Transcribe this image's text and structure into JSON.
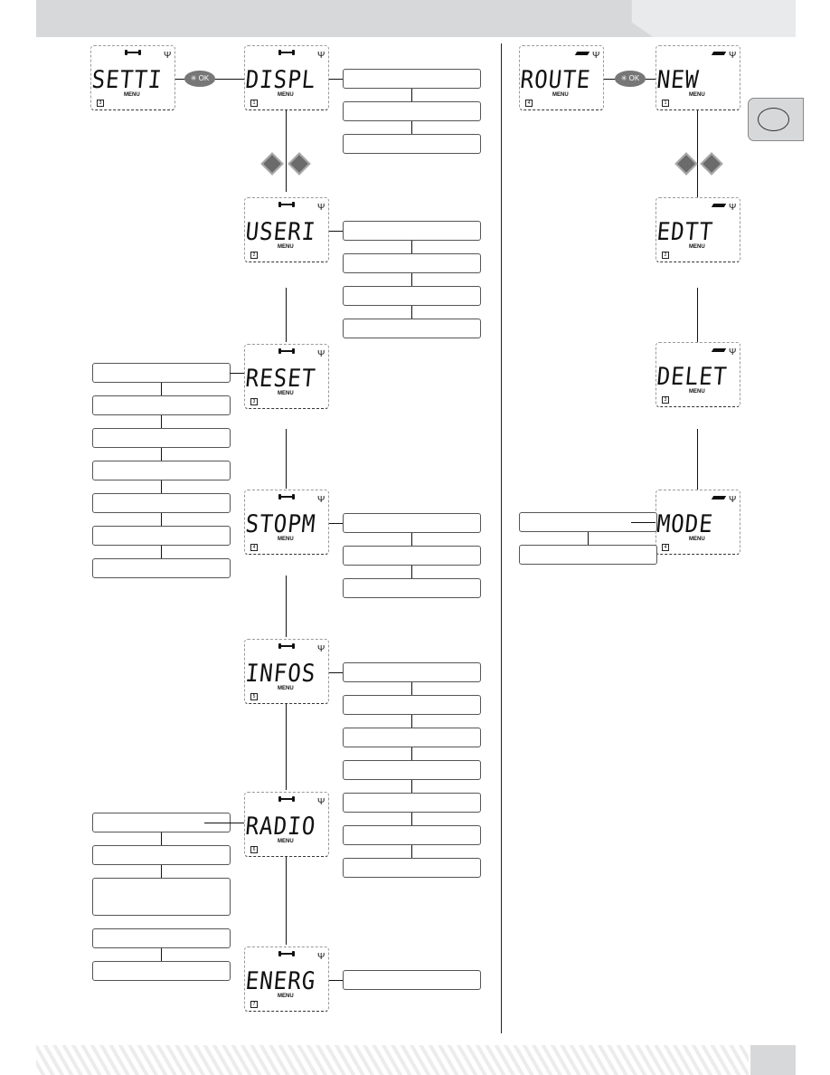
{
  "settings_menu": {
    "root": {
      "label": "SETTI",
      "menu": "MENU",
      "index": "3",
      "icon": "wrench-icon"
    },
    "ok_button": "✳ OK",
    "items": [
      {
        "label": "DISPL",
        "menu": "MENU",
        "index": "1",
        "options": 3
      },
      {
        "label": "USERI",
        "menu": "MENU",
        "index": "2",
        "options": 4
      },
      {
        "label": "RESET",
        "menu": "MENU",
        "index": "3",
        "options": 7
      },
      {
        "label": "STOPM",
        "menu": "MENU",
        "index": "4",
        "options": 3
      },
      {
        "label": "INFOS",
        "menu": "MENU",
        "index": "5",
        "options": 7
      },
      {
        "label": "RADIO",
        "menu": "MENU",
        "index": "6",
        "options": 5
      },
      {
        "label": "ENERG",
        "menu": "MENU",
        "index": "7",
        "options": 1
      }
    ]
  },
  "route_menu": {
    "root": {
      "label": "ROUTE",
      "menu": "MENU",
      "index": "4",
      "icon": "route-icon"
    },
    "ok_button": "✳ OK",
    "items": [
      {
        "label": "NEW",
        "menu": "MENU",
        "index": "1"
      },
      {
        "label": "EDTT",
        "menu": "MENU",
        "index": "2"
      },
      {
        "label": "DELET",
        "menu": "MENU",
        "index": "3"
      },
      {
        "label": "MODE",
        "menu": "MENU",
        "index": "4",
        "options": 2
      }
    ]
  },
  "navigation": {
    "left_arrow": "nav-left-icon",
    "right_arrow": "nav-right-icon"
  },
  "signal_glyph": "Ψ"
}
